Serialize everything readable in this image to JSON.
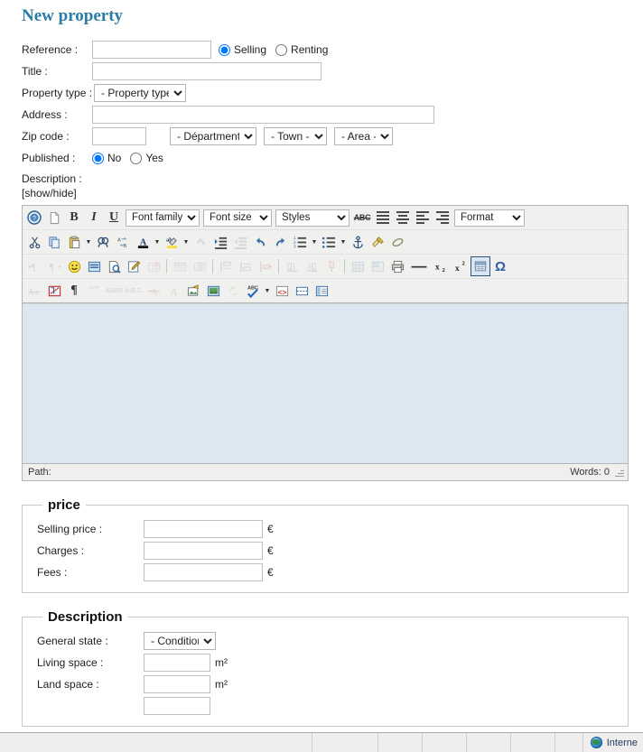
{
  "page": {
    "title": "New property"
  },
  "form": {
    "reference": {
      "label": "Reference :",
      "value": ""
    },
    "deal_type": {
      "options": [
        "Selling",
        "Renting"
      ],
      "selected": "Selling"
    },
    "title": {
      "label": "Title :",
      "value": ""
    },
    "property_type": {
      "label": "Property type :",
      "selected": "- Property type -"
    },
    "address": {
      "label": "Address :",
      "value": ""
    },
    "zip_code": {
      "label": "Zip code :",
      "value": ""
    },
    "department": {
      "selected": "- Départment -"
    },
    "town": {
      "selected": "- Town -"
    },
    "area": {
      "selected": "- Area -"
    },
    "published": {
      "label": "Published :",
      "options": [
        "No",
        "Yes"
      ],
      "selected": "No"
    },
    "description": {
      "label": "Description :",
      "toggle": "[show/hide]"
    }
  },
  "editor": {
    "row1": {
      "help_icon": "help-icon",
      "newdoc_icon": "new-document-icon",
      "bold": "B",
      "italic": "I",
      "underline": "U",
      "font_family": "Font family",
      "font_size": "Font size",
      "styles": "Styles",
      "strikethrough": "ABC",
      "format": "Format"
    },
    "statusbar": {
      "path_label": "Path:",
      "words_label": "Words: 0"
    }
  },
  "price_section": {
    "legend": "price",
    "fields": [
      {
        "label": "Selling price :",
        "value": "",
        "unit": "€"
      },
      {
        "label": "Charges :",
        "value": "",
        "unit": "€"
      },
      {
        "label": "Fees :",
        "value": "",
        "unit": "€"
      }
    ]
  },
  "description_section": {
    "legend": "Description",
    "general_state": {
      "label": "General state :",
      "selected": "- Condition -"
    },
    "fields": [
      {
        "label": "Living space :",
        "value": "",
        "unit": "m²"
      },
      {
        "label": "Land space :",
        "value": "",
        "unit": "m²"
      }
    ]
  },
  "browser_status": {
    "zone": "Interne"
  }
}
